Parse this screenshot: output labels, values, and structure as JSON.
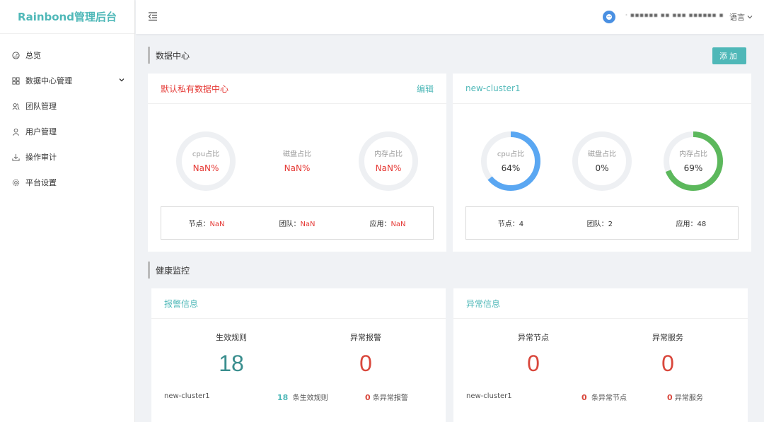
{
  "app": {
    "logo": "Rainbond管理后台"
  },
  "sidebar": {
    "items": [
      {
        "label": "总览",
        "icon": "dashboard-icon"
      },
      {
        "label": "数据中心管理",
        "icon": "grid-icon"
      },
      {
        "label": "团队管理",
        "icon": "team-icon"
      },
      {
        "label": "用户管理",
        "icon": "user-icon"
      },
      {
        "label": "操作审计",
        "icon": "download-icon"
      },
      {
        "label": "平台设置",
        "icon": "gear-icon"
      }
    ]
  },
  "header": {
    "username": "· ▪▪▪▪▪▪ ▪▪ ▪▪▪ ▪▪▪▪▪▪ ▪",
    "lang": "语言"
  },
  "datacenter": {
    "title": "数据中心",
    "add_label": "添加",
    "clusters": [
      {
        "name": "默认私有数据中心",
        "edit_label": "编辑",
        "gauges": [
          {
            "label": "cpu占比",
            "value": "NaN%",
            "percent": 0
          },
          {
            "label": "磁盘占比",
            "value": "NaN%",
            "percent": 0
          },
          {
            "label": "内存占比",
            "value": "NaN%",
            "percent": 0
          }
        ],
        "stats": [
          {
            "label": "节点：",
            "value": "NaN"
          },
          {
            "label": "团队：",
            "value": "NaN"
          },
          {
            "label": "应用：",
            "value": "NaN"
          }
        ]
      },
      {
        "name": "new-cluster1",
        "gauges": [
          {
            "label": "cpu占比",
            "value": "64%",
            "percent": 64,
            "color": "#5aa7f2"
          },
          {
            "label": "磁盘占比",
            "value": "0%",
            "percent": 0
          },
          {
            "label": "内存占比",
            "value": "69%",
            "percent": 69,
            "color": "#5cb85c"
          }
        ],
        "stats": [
          {
            "label": "节点：",
            "value": "4"
          },
          {
            "label": "团队：",
            "value": "2"
          },
          {
            "label": "应用：",
            "value": "48"
          }
        ]
      }
    ]
  },
  "health": {
    "title": "健康监控",
    "alerts": {
      "title": "报警信息",
      "col1_label": "生效规则",
      "col1_value": "18",
      "col2_label": "异常报警",
      "col2_value": "0",
      "cluster": "new-cluster1",
      "foot1_num": "18",
      "foot1_text": "条生效规则",
      "foot2_num": "0",
      "foot2_text": "条异常报警"
    },
    "anomalies": {
      "title": "异常信息",
      "col1_label": "异常节点",
      "col1_value": "0",
      "col2_label": "异常服务",
      "col2_value": "0",
      "cluster": "new-cluster1",
      "foot1_num": "0",
      "foot1_text": "条异常节点",
      "foot2_num": "0",
      "foot2_text": "异常服务"
    }
  }
}
